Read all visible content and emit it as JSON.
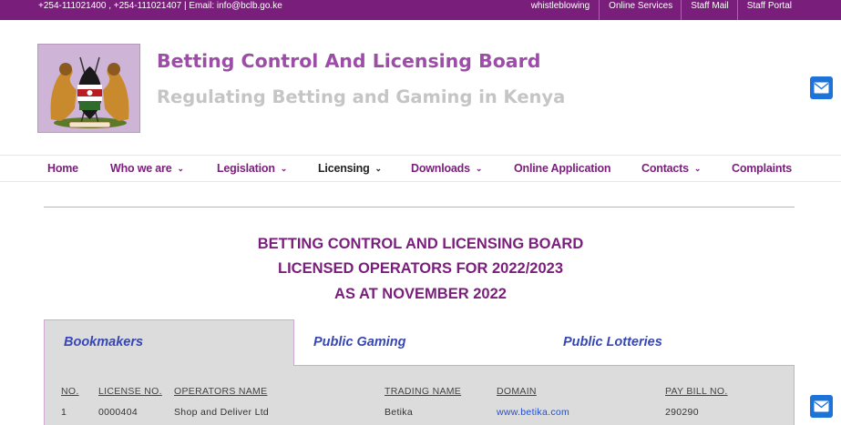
{
  "topbar": {
    "contact": "+254-111021400 , +254-111021407  |  Email: info@bclb.go.ke",
    "links": [
      "whistleblowing",
      "Online Services",
      "Staff Mail",
      "Staff Portal"
    ]
  },
  "header": {
    "title": "Betting Control And Licensing Board",
    "tagline": "Regulating Betting and Gaming in Kenya",
    "logo_icon": "kenya-coat-of-arms-icon"
  },
  "nav": {
    "items": [
      {
        "label": "Home",
        "dropdown": false
      },
      {
        "label": "Who we are",
        "dropdown": true
      },
      {
        "label": "Legislation",
        "dropdown": true
      },
      {
        "label": "Licensing",
        "dropdown": true,
        "active": true
      },
      {
        "label": "Downloads",
        "dropdown": true
      },
      {
        "label": "Online Application",
        "dropdown": false
      },
      {
        "label": "Contacts",
        "dropdown": true
      },
      {
        "label": "Complaints",
        "dropdown": false
      }
    ]
  },
  "page": {
    "heading_lines": [
      "BETTING CONTROL AND LICENSING BOARD",
      "LICENSED OPERATORS FOR 2022/2023",
      "AS AT NOVEMBER 2022"
    ]
  },
  "tabs": [
    "Bookmakers",
    "Public Gaming",
    "Public Lotteries"
  ],
  "table": {
    "columns": [
      "NO.",
      "LICENSE NO.",
      "OPERATORS NAME",
      "TRADING NAME",
      "DOMAIN",
      "PAY BILL NO."
    ],
    "rows": [
      [
        "1",
        "0000404",
        "Shop and Deliver Ltd",
        "Betika",
        "www.betika.com",
        "290290"
      ]
    ]
  },
  "colors": {
    "brand_purple": "#7a1e7b",
    "title_purple": "#9c4ea7",
    "tab_blue": "#3646b7",
    "link_blue": "#1e4ed8",
    "mail_blue": "#1e73d9"
  },
  "icons": {
    "chevron": "chevron-down-icon",
    "mail": "envelope-icon"
  }
}
